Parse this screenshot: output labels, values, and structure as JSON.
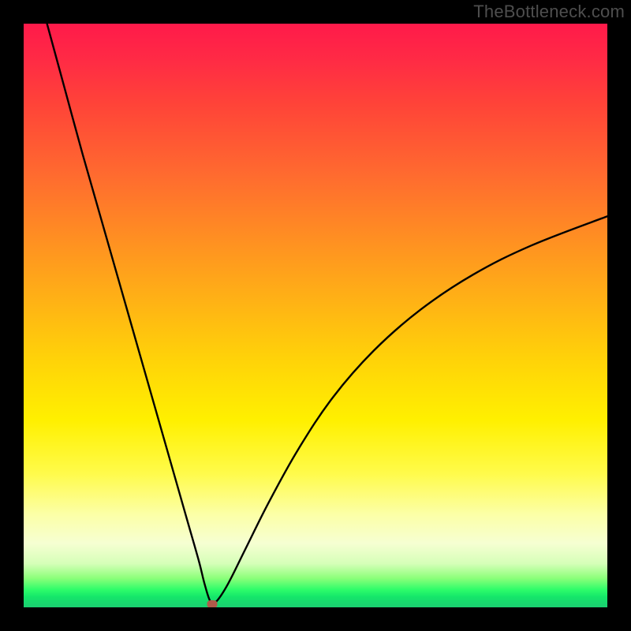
{
  "watermark": "TheBottleneck.com",
  "chart_data": {
    "type": "line",
    "title": "",
    "xlabel": "",
    "ylabel": "",
    "xlim": [
      0,
      100
    ],
    "ylim": [
      0,
      100
    ],
    "grid": false,
    "series": [
      {
        "name": "curve",
        "x": [
          4,
          7,
          10,
          14,
          18,
          22,
          26,
          28,
          30,
          31,
          32,
          33,
          35,
          38,
          42,
          47,
          53,
          60,
          68,
          77,
          87,
          100
        ],
        "values": [
          100,
          89,
          78,
          64,
          50,
          36,
          22,
          15,
          8,
          4,
          1,
          1,
          4,
          10,
          18,
          27,
          36,
          44,
          51,
          57,
          62,
          67
        ]
      }
    ],
    "marker": {
      "x": 32.3,
      "y": 0.6,
      "color": "#b15a4a"
    },
    "background_gradient": {
      "direction": "vertical",
      "stops": [
        {
          "pos": 0,
          "color": "#ff1a4a"
        },
        {
          "pos": 0.3,
          "color": "#ff7a28"
        },
        {
          "pos": 0.6,
          "color": "#ffe205"
        },
        {
          "pos": 0.88,
          "color": "#f7ffcf"
        },
        {
          "pos": 0.97,
          "color": "#2dfc6a"
        },
        {
          "pos": 1.0,
          "color": "#1bcf71"
        }
      ]
    }
  }
}
